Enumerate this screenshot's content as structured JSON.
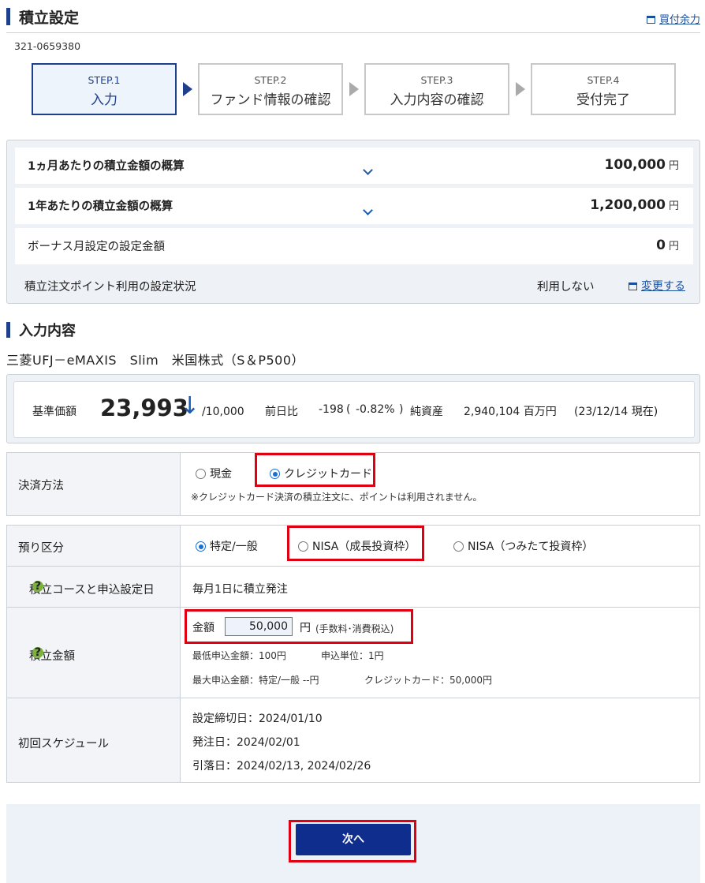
{
  "header": {
    "title": "積立設定",
    "link": "買付余力"
  },
  "account_no": "321-0659380",
  "steps": [
    {
      "num": "STEP.1",
      "name": "入力"
    },
    {
      "num": "STEP.2",
      "name": "ファンド情報の確認"
    },
    {
      "num": "STEP.3",
      "name": "入力内容の確認"
    },
    {
      "num": "STEP.4",
      "name": "受付完了"
    }
  ],
  "summary": {
    "monthly_label": "1ヵ月あたりの積立金額の概算",
    "monthly_value": "100,000",
    "yearly_label": "1年あたりの積立金額の概算",
    "yearly_value": "1,200,000",
    "bonus_label": "ボーナス月設定の設定金額",
    "bonus_value": "0",
    "yen": "円",
    "point_label": "積立注文ポイント利用の設定状況",
    "point_status": "利用しない",
    "change_link": "変更する"
  },
  "section_title": "入力内容",
  "fund_name": "三菱UFJ－eMAXIS　Slim　米国株式（S＆P500）",
  "price": {
    "label": "基準価額",
    "value": "23,993",
    "arrow": "↓",
    "unit": "/10,000",
    "prev_label": "前日比",
    "change": "-198",
    "change_pct": "-0.82%",
    "net_assets_label": "純資産",
    "net_assets": "2,940,104 百万円",
    "as_of": "(23/12/14 現在)"
  },
  "payment": {
    "label": "決済方法",
    "opt_cash": "現金",
    "opt_credit": "クレジットカード",
    "note": "※クレジットカード決済の積立注文に、ポイントは利用されません。"
  },
  "custody": {
    "label": "預り区分",
    "opt_specific": "特定/一般",
    "opt_nisa_growth": "NISA（成長投資枠）",
    "opt_nisa_tsumitate": "NISA（つみたて投資枠）"
  },
  "course": {
    "label": "積立コースと申込設定日",
    "value": "毎月1日に積立発注"
  },
  "amount": {
    "label": "積立金額",
    "field_label": "金額",
    "value": "50,000",
    "unit": "円",
    "unit_note": "(手数料･消費税込)",
    "min_label": "最低申込金額：100円",
    "unit_label": "申込単位：1円",
    "max_label": "最大申込金額：特定/一般 --円",
    "credit_label": "クレジットカード：50,000円"
  },
  "schedule": {
    "label": "初回スケジュール",
    "deadline": "設定締切日：2024/01/10",
    "order": "発注日：2024/02/01",
    "debit": "引落日：2024/02/13, 2024/02/26"
  },
  "next_button": "次へ",
  "colors": {
    "accent": "#1e3f8b",
    "highlight": "#e00012",
    "link": "#1a4f9c"
  }
}
